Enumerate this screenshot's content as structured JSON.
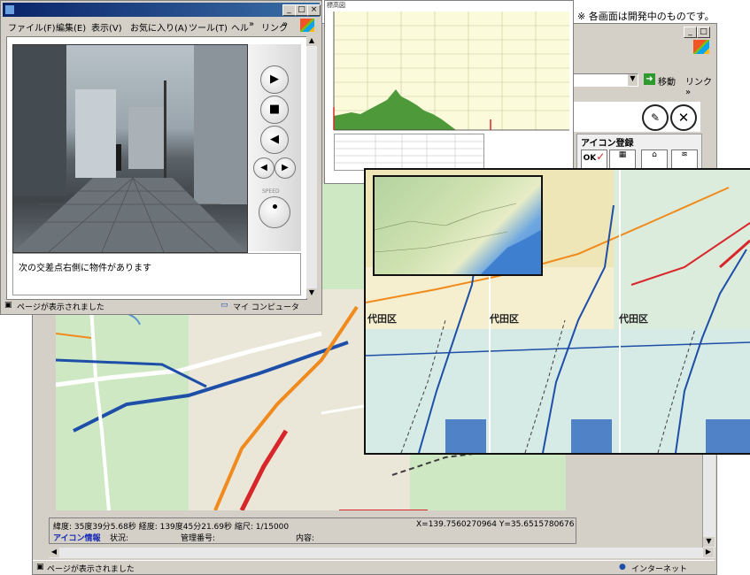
{
  "note": "※ 各画面は開発中のものです。",
  "map_window": {
    "address_go_label": "移動",
    "links_label": "リンク »",
    "icon_panel_title": "アイコン登録",
    "icon_ok_label": "OK",
    "coords_line": "緯度: 35度39分5.68秒  経度: 139度45分21.69秒  縮尺: 1/15000",
    "xy_readout": "X=139.7560270964 Y=35.6515780676",
    "info_label": "アイコン情報",
    "status_label": "状況:",
    "mgmt_label": "管理番号:",
    "content_label": "内容:",
    "statusbar_text": "ページが表示されました",
    "zone_label": "インターネット"
  },
  "video_window": {
    "menu": [
      "ファイル(F)",
      "編集(E)",
      "表示(V)",
      "お気に入り(A)",
      "ツール(T)",
      "ヘル",
      "»",
      "リンク",
      "»"
    ],
    "speed_label": "SPEED",
    "message": "次の交差点右側に物件があります",
    "statusbar_text": "ページが表示されました",
    "zone_label": "マイ コンピュータ"
  },
  "chart_window": {
    "title": "標高図"
  },
  "overlay_map": {
    "ward_labels": [
      "代田区",
      "代田区",
      "代田区"
    ]
  },
  "colors": {
    "title_active": "#0a246a",
    "map_bg": "#f1efe6",
    "map_green": "#cfe8c4",
    "route_blue": "#1e4fa8",
    "route_red": "#d8262a",
    "route_orange": "#f08a1c",
    "water": "#5b8fd1",
    "info_blue": "#1428b4"
  }
}
